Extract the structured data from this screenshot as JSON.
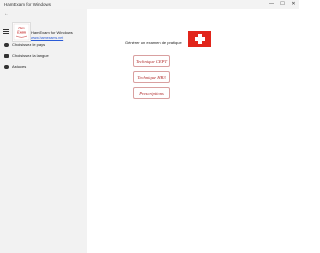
{
  "window": {
    "title": "HamExam for Windows",
    "controls": {
      "minimize": "—",
      "maximize": "☐",
      "close": "✕"
    }
  },
  "sidebar": {
    "back_glyph": "←",
    "app_name": "HamExam for Windows",
    "app_url": "www.hamexams.net",
    "logo_text_1": "Ham",
    "logo_text_2": "Exam",
    "items": [
      {
        "label": "Choisissez le pays",
        "icon": "globe-icon"
      },
      {
        "label": "Choisissez la langue",
        "icon": "language-icon"
      },
      {
        "label": "Astuces",
        "icon": "info-icon"
      }
    ]
  },
  "main": {
    "prompt": "Générer un examen de pratique",
    "flag": "switzerland-flag",
    "buttons": [
      {
        "label": "Technique CEPT"
      },
      {
        "label": "Technique HB3"
      },
      {
        "label": "Prescriptions"
      }
    ]
  },
  "colors": {
    "accent": "#b02a2a",
    "flag_red": "#e1251b",
    "sidebar_bg": "#f2f2f2",
    "link": "#2a5bd7"
  }
}
